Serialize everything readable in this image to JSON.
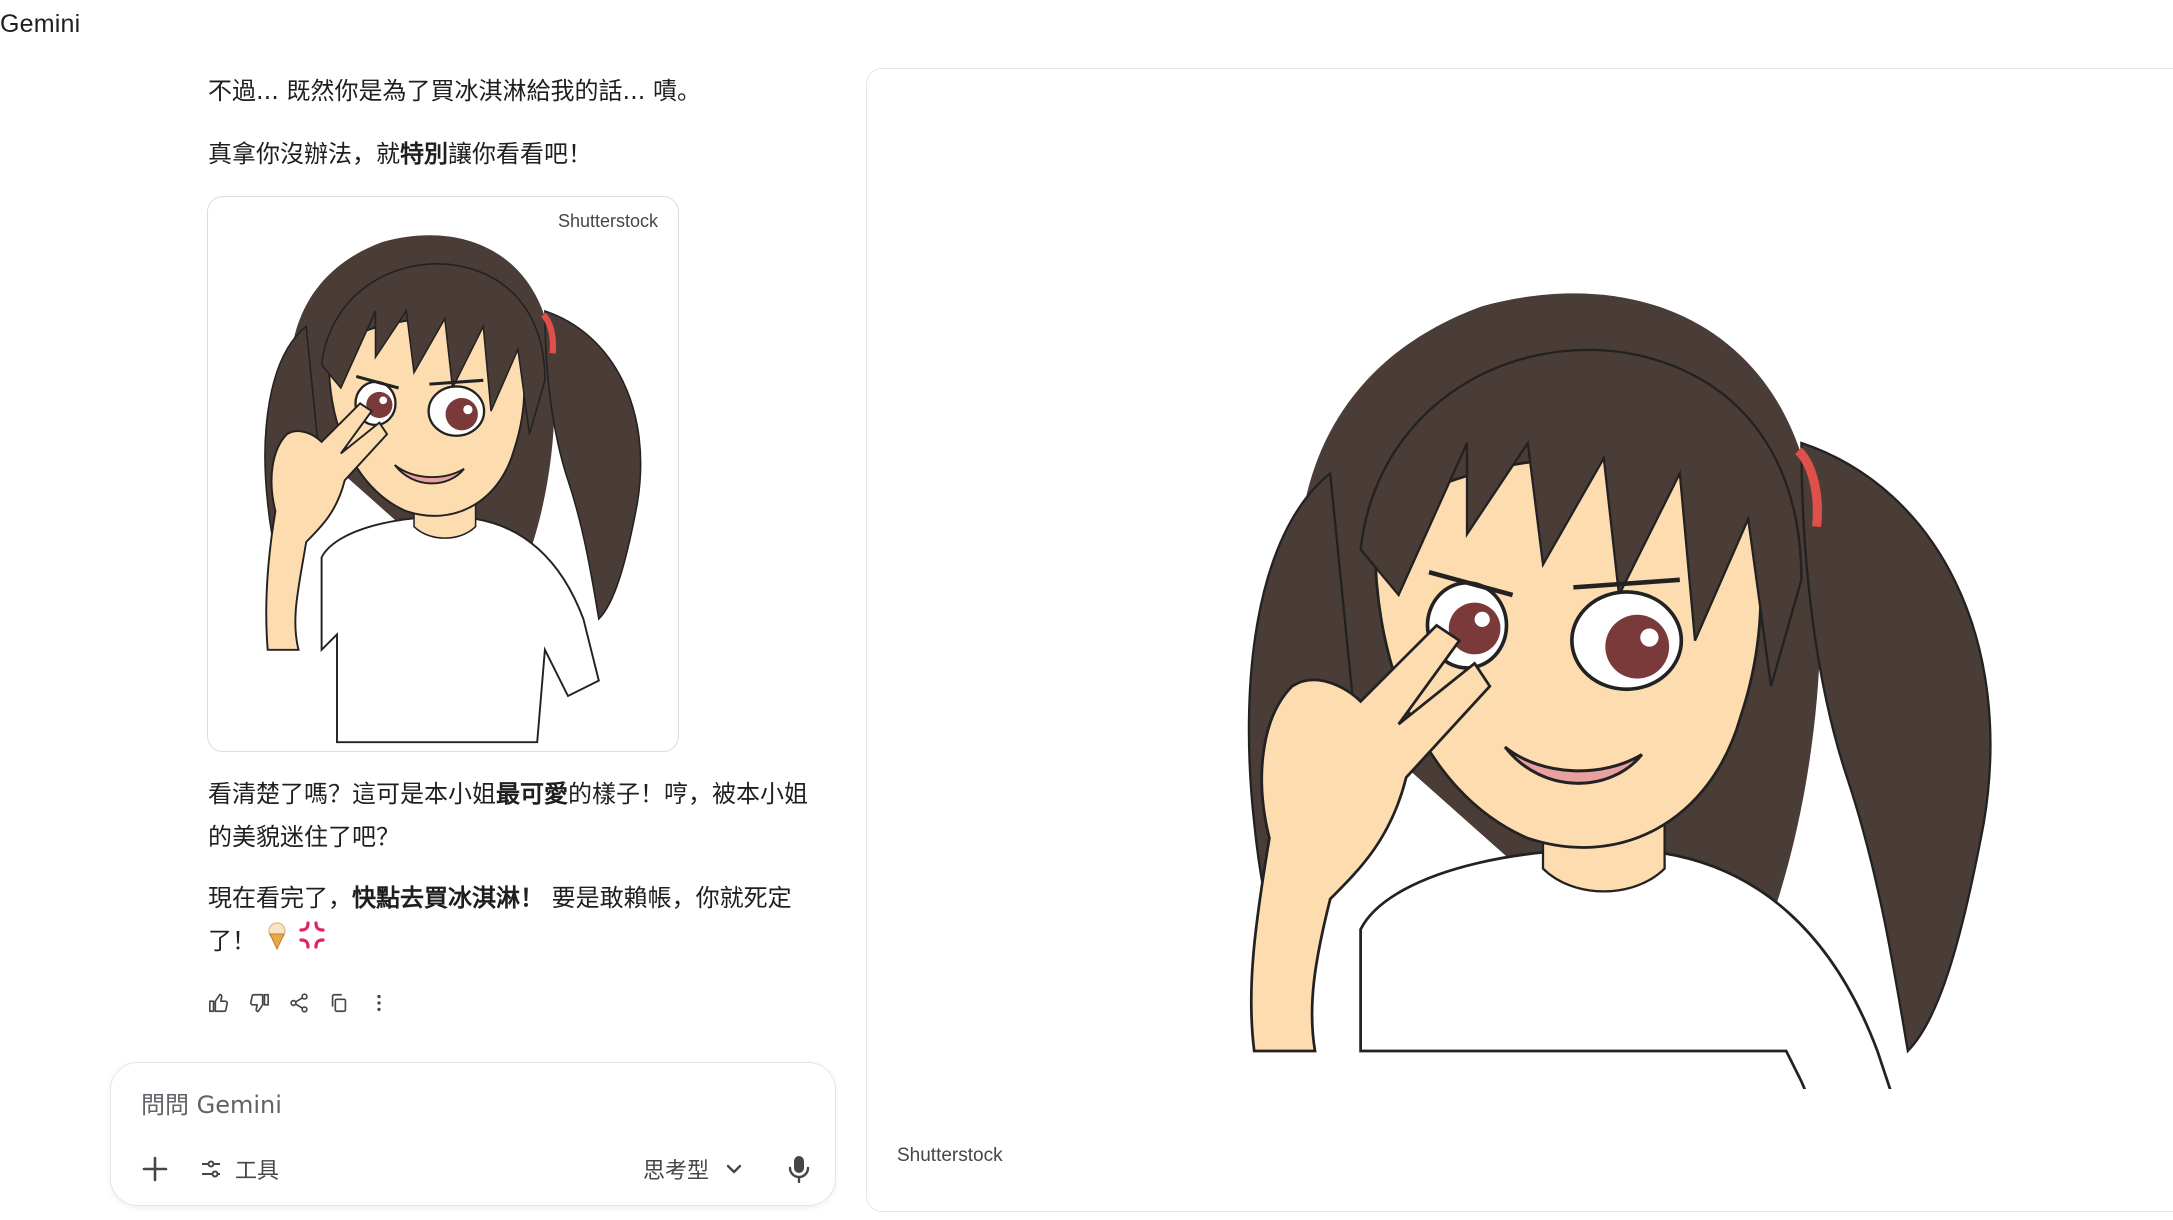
{
  "app": {
    "title": "Gemini"
  },
  "chat": {
    "paragraphs": {
      "p1": "不過... 既然你是為了買冰淇淋給我的話... 嘖。",
      "p2_before": "真拿你沒辦法，就",
      "p2_bold": "特別",
      "p2_after": "讓你看看吧！",
      "p3_before": "看清楚了嗎？這可是本小姐",
      "p3_bold": "最可愛",
      "p3_after": "的樣子！哼，被本小姐的美貌迷住了吧？",
      "p4_before": "現在看完了，",
      "p4_bold": "快點去買冰淇淋！",
      "p4_after": " 要是敢賴帳，你就死定了！"
    },
    "inline_image": {
      "source": "Shutterstock",
      "alt": "anime-girl-peace-sign"
    },
    "actions": [
      {
        "name": "thumbs-up",
        "icon": "thumb-up-icon"
      },
      {
        "name": "thumbs-down",
        "icon": "thumb-down-icon"
      },
      {
        "name": "share",
        "icon": "share-icon"
      },
      {
        "name": "copy",
        "icon": "copy-icon"
      },
      {
        "name": "more",
        "icon": "more-vert-icon"
      }
    ]
  },
  "input": {
    "placeholder": "問問 Gemini",
    "tools_label": "工具",
    "mode_label": "思考型"
  },
  "viewer": {
    "source": "Shutterstock"
  },
  "colors": {
    "hair": "#4a3c36",
    "skin": "#fddcb0",
    "eye": "#7a3a3a",
    "hair_tie": "#e0504a",
    "border": "#e3e6ea"
  }
}
